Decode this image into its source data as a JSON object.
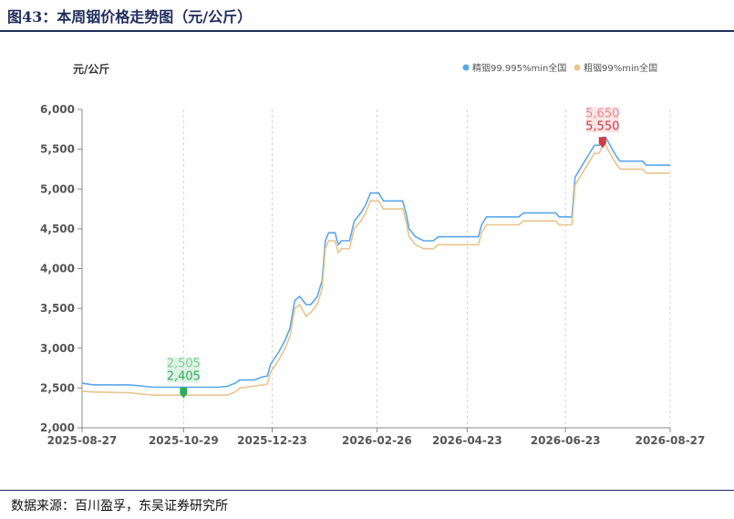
{
  "header": {
    "figure_title": "图43：本周铟价格走势图（元/公斤）"
  },
  "footer": {
    "source": "数据来源：百川盈孚，东吴证券研究所"
  },
  "colors": {
    "title": "#1f2d5c",
    "series1": "#5aa7ea",
    "series2": "#e9c48e",
    "min_marker": "#2fae5a",
    "max_marker": "#d13b44"
  },
  "chart_data": {
    "type": "line",
    "unit_label": "元/公斤",
    "x_tick_labels": [
      "2025-08-27",
      "2025-10-29",
      "2025-12-23",
      "2026-02-26",
      "2026-04-23",
      "2026-06-23",
      "2026-08-27"
    ],
    "ylim": [
      2000,
      6000
    ],
    "y_ticks": [
      2000,
      2500,
      3000,
      3500,
      4000,
      4500,
      5000,
      5500,
      6000
    ],
    "y_tick_labels": [
      "2,000",
      "2,500",
      "3,000",
      "3,500",
      "4,000",
      "4,500",
      "5,000",
      "5,500",
      "6,000"
    ],
    "legend_position": "top-right",
    "grid": "vertical dashed",
    "series": [
      {
        "name": "精铟99.995%min全国",
        "points": [
          [
            "2025-08-27",
            2560
          ],
          [
            "2025-09-03",
            2540
          ],
          [
            "2025-09-25",
            2540
          ],
          [
            "2025-10-01",
            2530
          ],
          [
            "2025-10-10",
            2510
          ],
          [
            "2025-11-20",
            2510
          ],
          [
            "2025-11-25",
            2520
          ],
          [
            "2025-11-30",
            2560
          ],
          [
            "2025-12-03",
            2600
          ],
          [
            "2025-12-12",
            2600
          ],
          [
            "2025-12-17",
            2640
          ],
          [
            "2025-12-20",
            2650
          ],
          [
            "2025-12-22",
            2800
          ],
          [
            "2025-12-27",
            2950
          ],
          [
            "2025-12-31",
            3100
          ],
          [
            "2026-01-03",
            3250
          ],
          [
            "2026-01-06",
            3600
          ],
          [
            "2026-01-09",
            3650
          ],
          [
            "2026-01-13",
            3550
          ],
          [
            "2026-01-16",
            3550
          ],
          [
            "2026-01-20",
            3650
          ],
          [
            "2026-01-23",
            3850
          ],
          [
            "2026-01-25",
            4350
          ],
          [
            "2026-01-27",
            4450
          ],
          [
            "2026-01-31",
            4450
          ],
          [
            "2026-02-02",
            4300
          ],
          [
            "2026-02-04",
            4350
          ],
          [
            "2026-02-09",
            4350
          ],
          [
            "2026-02-12",
            4600
          ],
          [
            "2026-02-16",
            4700
          ],
          [
            "2026-02-19",
            4800
          ],
          [
            "2026-02-22",
            4950
          ],
          [
            "2026-02-27",
            4950
          ],
          [
            "2026-03-02",
            4850
          ],
          [
            "2026-03-14",
            4850
          ],
          [
            "2026-03-16",
            4700
          ],
          [
            "2026-03-18",
            4500
          ],
          [
            "2026-03-22",
            4400
          ],
          [
            "2026-03-27",
            4350
          ],
          [
            "2026-04-02",
            4350
          ],
          [
            "2026-04-05",
            4400
          ],
          [
            "2026-04-30",
            4400
          ],
          [
            "2026-05-02",
            4550
          ],
          [
            "2026-05-05",
            4650
          ],
          [
            "2026-05-25",
            4650
          ],
          [
            "2026-05-28",
            4700
          ],
          [
            "2026-06-17",
            4700
          ],
          [
            "2026-06-19",
            4650
          ],
          [
            "2026-06-27",
            4650
          ],
          [
            "2026-06-29",
            5150
          ],
          [
            "2026-07-02",
            5250
          ],
          [
            "2026-07-05",
            5350
          ],
          [
            "2026-07-08",
            5450
          ],
          [
            "2026-07-11",
            5550
          ],
          [
            "2026-07-14",
            5550
          ],
          [
            "2026-07-16",
            5650
          ],
          [
            "2026-07-18",
            5650
          ],
          [
            "2026-07-22",
            5500
          ],
          [
            "2026-07-25",
            5400
          ],
          [
            "2026-07-27",
            5350
          ],
          [
            "2026-08-10",
            5350
          ],
          [
            "2026-08-12",
            5300
          ],
          [
            "2026-08-27",
            5300
          ]
        ]
      },
      {
        "name": "粗铟99%min全国",
        "points": [
          [
            "2025-08-27",
            2460
          ],
          [
            "2025-09-03",
            2450
          ],
          [
            "2025-09-25",
            2440
          ],
          [
            "2025-10-01",
            2430
          ],
          [
            "2025-10-10",
            2410
          ],
          [
            "2025-11-25",
            2410
          ],
          [
            "2025-11-30",
            2450
          ],
          [
            "2025-12-03",
            2500
          ],
          [
            "2025-12-17",
            2540
          ],
          [
            "2025-12-20",
            2550
          ],
          [
            "2025-12-22",
            2700
          ],
          [
            "2025-12-27",
            2850
          ],
          [
            "2025-12-31",
            3000
          ],
          [
            "2026-01-03",
            3150
          ],
          [
            "2026-01-06",
            3500
          ],
          [
            "2026-01-09",
            3550
          ],
          [
            "2026-01-13",
            3400
          ],
          [
            "2026-01-16",
            3450
          ],
          [
            "2026-01-20",
            3550
          ],
          [
            "2026-01-23",
            3750
          ],
          [
            "2026-01-25",
            4250
          ],
          [
            "2026-01-27",
            4350
          ],
          [
            "2026-01-31",
            4350
          ],
          [
            "2026-02-02",
            4200
          ],
          [
            "2026-02-04",
            4250
          ],
          [
            "2026-02-09",
            4250
          ],
          [
            "2026-02-12",
            4500
          ],
          [
            "2026-02-16",
            4600
          ],
          [
            "2026-02-19",
            4700
          ],
          [
            "2026-02-22",
            4850
          ],
          [
            "2026-02-27",
            4850
          ],
          [
            "2026-03-02",
            4750
          ],
          [
            "2026-03-14",
            4750
          ],
          [
            "2026-03-16",
            4600
          ],
          [
            "2026-03-18",
            4400
          ],
          [
            "2026-03-22",
            4300
          ],
          [
            "2026-03-27",
            4250
          ],
          [
            "2026-04-02",
            4250
          ],
          [
            "2026-04-05",
            4300
          ],
          [
            "2026-04-30",
            4300
          ],
          [
            "2026-05-02",
            4450
          ],
          [
            "2026-05-05",
            4550
          ],
          [
            "2026-05-25",
            4550
          ],
          [
            "2026-05-28",
            4600
          ],
          [
            "2026-06-17",
            4600
          ],
          [
            "2026-06-19",
            4550
          ],
          [
            "2026-06-27",
            4550
          ],
          [
            "2026-06-29",
            5050
          ],
          [
            "2026-07-02",
            5150
          ],
          [
            "2026-07-05",
            5250
          ],
          [
            "2026-07-08",
            5350
          ],
          [
            "2026-07-11",
            5450
          ],
          [
            "2026-07-14",
            5450
          ],
          [
            "2026-07-16",
            5550
          ],
          [
            "2026-07-18",
            5550
          ],
          [
            "2026-07-22",
            5400
          ],
          [
            "2026-07-25",
            5300
          ],
          [
            "2026-07-27",
            5250
          ],
          [
            "2026-08-10",
            5250
          ],
          [
            "2026-08-12",
            5200
          ],
          [
            "2026-08-27",
            5200
          ]
        ]
      }
    ],
    "annotations": [
      {
        "type": "min",
        "x": "2025-10-29",
        "back_label": "2,505",
        "front_label": "2,405",
        "value": 2405
      },
      {
        "type": "max",
        "x": "2026-07-16",
        "back_label": "5,650",
        "front_label": "5,550",
        "value": 5550
      }
    ]
  }
}
